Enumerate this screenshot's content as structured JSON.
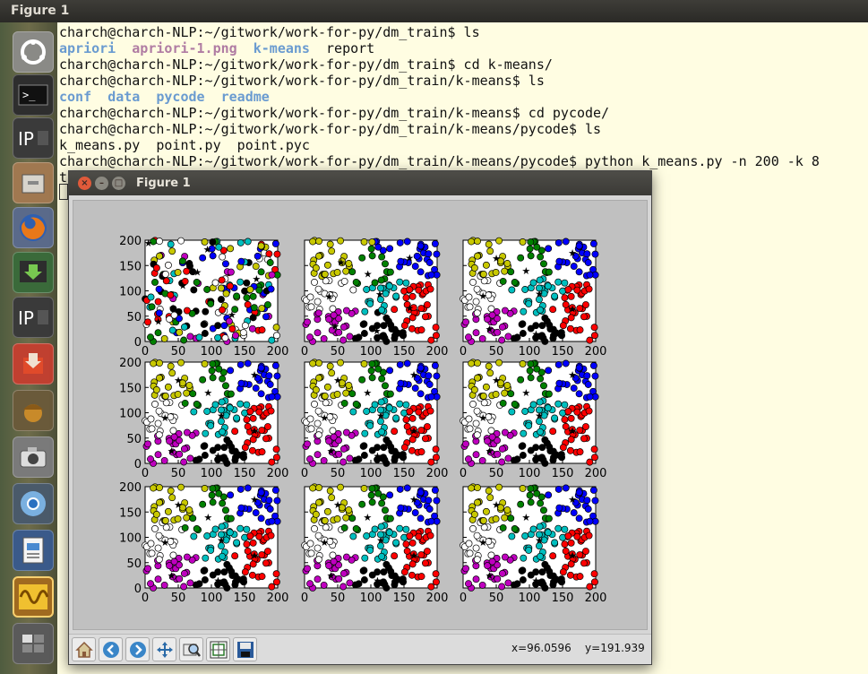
{
  "topbar": {
    "title": "Figure 1"
  },
  "terminal": {
    "lines": [
      [
        {
          "t": "charch@charch-NLP:~/gitwork/work-for-py/dm_train$ ls",
          "c": ""
        }
      ],
      [
        {
          "t": "apriori",
          "c": "b"
        },
        {
          "t": "  ",
          "c": ""
        },
        {
          "t": "apriori-1.png",
          "c": "m"
        },
        {
          "t": "  ",
          "c": ""
        },
        {
          "t": "k-means",
          "c": "b"
        },
        {
          "t": "  report",
          "c": ""
        }
      ],
      [
        {
          "t": "charch@charch-NLP:~/gitwork/work-for-py/dm_train$ cd k-means/",
          "c": ""
        }
      ],
      [
        {
          "t": "charch@charch-NLP:~/gitwork/work-for-py/dm_train/k-means$ ls",
          "c": ""
        }
      ],
      [
        {
          "t": "conf",
          "c": "b"
        },
        {
          "t": "  ",
          "c": ""
        },
        {
          "t": "data",
          "c": "b"
        },
        {
          "t": "  ",
          "c": ""
        },
        {
          "t": "pycode",
          "c": "b"
        },
        {
          "t": "  ",
          "c": ""
        },
        {
          "t": "readme",
          "c": "b"
        }
      ],
      [
        {
          "t": "charch@charch-NLP:~/gitwork/work-for-py/dm_train/k-means$ cd pycode/",
          "c": ""
        }
      ],
      [
        {
          "t": "charch@charch-NLP:~/gitwork/work-for-py/dm_train/k-means/pycode$ ls",
          "c": ""
        }
      ],
      [
        {
          "t": "k_means.py  point.py  point.pyc",
          "c": ""
        }
      ],
      [
        {
          "t": "charch@charch-NLP:~/gitwork/work-for-py/dm_train/k-means/pycode$ python k_means.py -n 200 -k 8",
          "c": ""
        }
      ],
      [
        {
          "t": "to",
          "c": ""
        }
      ]
    ]
  },
  "figure": {
    "title": "Figure 1",
    "coords": "x=96.0596    y=191.939"
  },
  "toolbar": {
    "buttons": [
      "home-icon",
      "back-icon",
      "forward-icon",
      "pan-icon",
      "zoom-icon",
      "subplots-icon",
      "save-icon"
    ]
  },
  "chart_data": {
    "type": "scatter",
    "layout": "3x3 grid of subplots",
    "xlim": [
      0,
      200
    ],
    "ylim": [
      0,
      200
    ],
    "xticks": [
      0,
      50,
      100,
      150,
      200
    ],
    "yticks": [
      0,
      50,
      100,
      150,
      200
    ],
    "cluster_colors": [
      "#c8c800",
      "#0000ff",
      "#008000",
      "#00bfbf",
      "#ffffff",
      "#ff0000",
      "#bf00bf",
      "#000000"
    ],
    "cluster_centers": [
      [
        50,
        165
      ],
      [
        165,
        175
      ],
      [
        95,
        140
      ],
      [
        115,
        95
      ],
      [
        30,
        90
      ],
      [
        165,
        65
      ],
      [
        40,
        25
      ],
      [
        110,
        15
      ]
    ],
    "centroid_marker": "star",
    "series_per_subplot": 8,
    "points_per_subplot": 200,
    "subplots": 9
  }
}
